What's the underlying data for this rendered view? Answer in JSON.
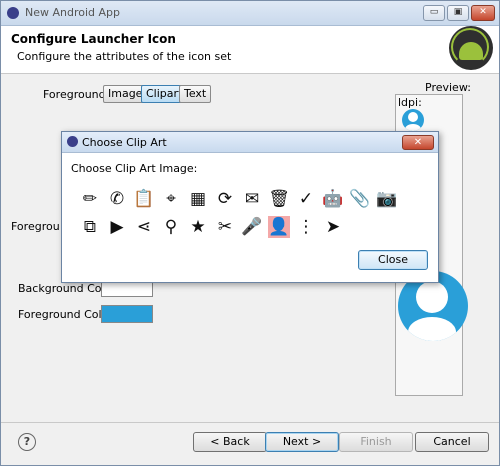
{
  "window": {
    "title": "New Android App",
    "minimize_label": "▭",
    "maximize_label": "▣",
    "close_label": "✕"
  },
  "header": {
    "title": "Configure Launcher Icon",
    "subtitle": "Configure the attributes of the icon set"
  },
  "form": {
    "foreground_label": "Foreground:",
    "foreground_options": [
      "Image",
      "Clipart",
      "Text"
    ],
    "selected_foreground": "Clipart",
    "foreground_scaling_label": "Foregrou",
    "background_color_label": "Background Color:",
    "foreground_color_label": "Foreground Color:",
    "background_color": "#ffffff",
    "foreground_color": "#2a9fd8"
  },
  "preview": {
    "label": "Preview:",
    "density_label": "ldpi:",
    "icon_color": "#2a9fd8"
  },
  "dialog": {
    "title": "Choose Clip Art",
    "prompt": "Choose Clip Art Image:",
    "close_button": "Close",
    "selected_icon": "user-icon",
    "icons_row1": [
      {
        "name": "pencil-icon",
        "glyph": "✏"
      },
      {
        "name": "phone-icon",
        "glyph": "✆"
      },
      {
        "name": "clipboard-icon",
        "glyph": "📋"
      },
      {
        "name": "crosshair-icon",
        "glyph": "⌖"
      },
      {
        "name": "grid-icon",
        "glyph": "▦"
      },
      {
        "name": "refresh-icon",
        "glyph": "⟳"
      },
      {
        "name": "email-icon",
        "glyph": "✉"
      },
      {
        "name": "trash-icon",
        "glyph": "🗑"
      },
      {
        "name": "check-icon",
        "glyph": "✓"
      },
      {
        "name": "android-icon",
        "glyph": "🤖"
      },
      {
        "name": "paperclip-icon",
        "glyph": "📎"
      },
      {
        "name": "camera-icon",
        "glyph": "📷"
      }
    ],
    "icons_row2": [
      {
        "name": "copy-icon",
        "glyph": "⧉"
      },
      {
        "name": "video-icon",
        "glyph": "▶"
      },
      {
        "name": "share-icon",
        "glyph": "⋖"
      },
      {
        "name": "search-icon",
        "glyph": "⚲"
      },
      {
        "name": "star-icon",
        "glyph": "★"
      },
      {
        "name": "cut-icon",
        "glyph": "✂"
      },
      {
        "name": "microphone-icon",
        "glyph": "🎤"
      },
      {
        "name": "user-icon",
        "glyph": "👤"
      },
      {
        "name": "more-vert-icon",
        "glyph": "⋮"
      },
      {
        "name": "send-icon",
        "glyph": "➤"
      }
    ]
  },
  "footer": {
    "help_label": "?",
    "back_label": "< Back",
    "next_label": "Next >",
    "finish_label": "Finish",
    "cancel_label": "Cancel"
  }
}
